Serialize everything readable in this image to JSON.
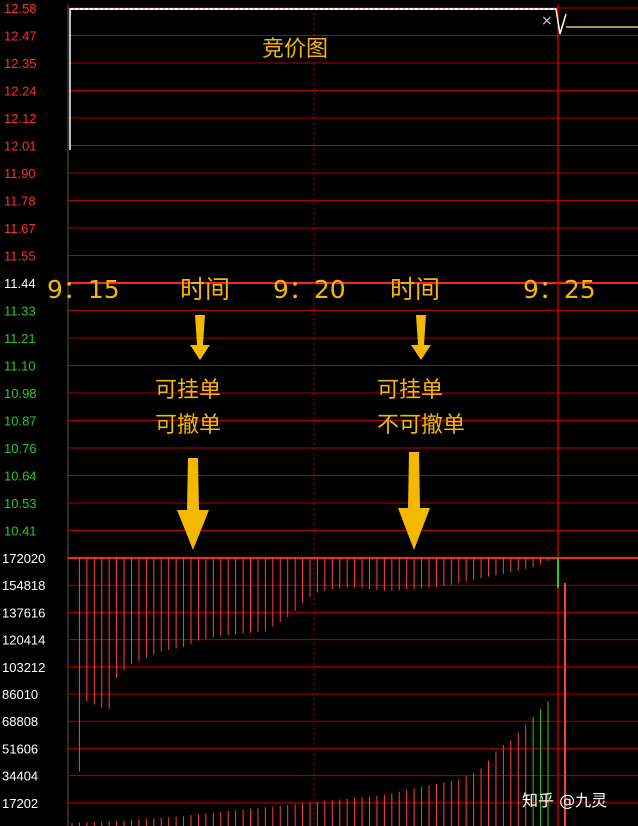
{
  "title": "竞价图",
  "price_axis": {
    "ticks": [
      "12.58",
      "12.47",
      "12.35",
      "12.24",
      "12.12",
      "12.01",
      "11.90",
      "11.78",
      "11.67",
      "11.55",
      "11.44",
      "11.33",
      "11.21",
      "11.10",
      "10.98",
      "10.87",
      "10.76",
      "10.64",
      "10.53",
      "10.41"
    ],
    "up_color": "#ff3030",
    "down_color": "#28c828",
    "mid_index": 10
  },
  "volume_axis": {
    "ticks": [
      "172020",
      "154818",
      "137616",
      "120414",
      "103212",
      "86010",
      "68808",
      "51606",
      "34404",
      "17202"
    ],
    "max": 172020
  },
  "time_labels": {
    "t1": "9：15",
    "t2": "9：20",
    "t3": "9：25",
    "l1": "时间",
    "l2": "时间"
  },
  "phase1": {
    "line1": "可挂单",
    "line2": "可撤单"
  },
  "phase2": {
    "line1": "可挂单",
    "line2": "不可撤单"
  },
  "close_glyph": "×",
  "watermark": "知乎 @九灵",
  "colors": {
    "grid": "#b00000",
    "accent": "#f5b800",
    "bar_red": "#ff4040",
    "bar_green": "#28c828",
    "price_line": "#ffffff",
    "yellow_line": "#d8c060"
  },
  "chart_data": {
    "type": "bar",
    "title": "竞价图",
    "xlabel": "时间",
    "ylabel": "",
    "x_ticks": [
      "9：15",
      "9：20",
      "9：25"
    ],
    "series": [
      {
        "values": [
          172020,
          35000,
          80000,
          78000,
          76000,
          75000,
          95000,
          100000,
          104000,
          106000,
          108000,
          110000,
          112000,
          113000,
          114000,
          115000,
          117000,
          119000,
          120000,
          121000,
          122000,
          122500,
          123000,
          123500,
          124000,
          124500,
          125000,
          128000,
          131000,
          134000,
          138000,
          143000,
          147000,
          150000,
          151000,
          152000,
          152500,
          153000,
          153000,
          152500,
          152000,
          151500,
          151000,
          151000,
          151500,
          152000,
          152000,
          152500,
          153000,
          153500,
          154000,
          155000,
          156000,
          157000,
          158000,
          159000,
          160000,
          161000,
          162000,
          163000,
          164000,
          165000,
          166000,
          168000,
          170000
        ],
        "down_values": [
          2000,
          2200,
          2400,
          2600,
          2800,
          3000,
          3200,
          3500,
          3800,
          4100,
          4400,
          4800,
          5200,
          5600,
          6000,
          6500,
          7000,
          7500,
          8000,
          8500,
          9000,
          9500,
          10000,
          10500,
          11000,
          11500,
          12000,
          12500,
          13000,
          13500,
          14000,
          14500,
          15000,
          15500,
          16000,
          16500,
          17000,
          17500,
          18000,
          18500,
          19000,
          19500,
          20000,
          21000,
          22000,
          23000,
          24000,
          25000,
          26000,
          27000,
          28000,
          29000,
          30000,
          32000,
          34000,
          37000,
          42000,
          48000,
          52000,
          55000,
          60000,
          65000,
          70000,
          75000,
          80000
        ]
      }
    ],
    "ylim": [
      0,
      172020
    ],
    "grid": true,
    "legend": "none"
  }
}
